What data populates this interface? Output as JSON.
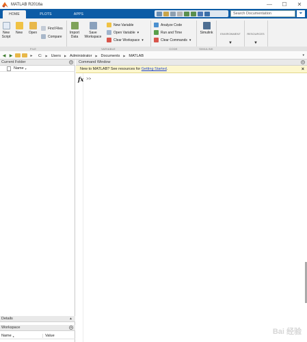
{
  "window": {
    "title": "MATLAB R2016a",
    "controls": [
      "—",
      "☐",
      "✕"
    ]
  },
  "tabs": [
    {
      "label": "HOME",
      "active": true
    },
    {
      "label": "PLOTS",
      "active": false
    },
    {
      "label": "APPS",
      "active": false
    }
  ],
  "search": {
    "placeholder": "Search Documentation"
  },
  "ribbon": {
    "file": {
      "label": "FILE",
      "new_script": "New Script",
      "new": "New",
      "open": "Open",
      "find_files": "Find Files",
      "compare": "Compare"
    },
    "variable": {
      "label": "VARIABLE",
      "import_data": "Import Data",
      "save_workspace": "Save Workspace",
      "new_variable": "New Variable",
      "open_variable": "Open Variable",
      "clear_workspace": "Clear Workspace"
    },
    "code": {
      "label": "CODE",
      "analyze_code": "Analyze Code",
      "run_and_time": "Run and Time",
      "clear_commands": "Clear Commands"
    },
    "simulink": {
      "label": "SIMULINK",
      "simulink": "Simulink"
    },
    "environment": "ENVIRONMENT",
    "resources": "RESOURCES"
  },
  "address": {
    "path": [
      "C:",
      "Users",
      "Administrator",
      "Documents",
      "MATLAB"
    ]
  },
  "panels": {
    "current_folder": {
      "title": "Current Folder",
      "name_col": "Name"
    },
    "details": {
      "title": "Details"
    },
    "workspace": {
      "title": "Workspace",
      "name_col": "Name",
      "value_col": "Value"
    }
  },
  "command_window": {
    "title": "Command Window",
    "banner_text": "New to MATLAB? See resources for ",
    "banner_link": "Getting Started",
    "banner_end": ".",
    "prompt": ">>"
  },
  "watermark": "Bai 经验",
  "colors": {
    "accent": "#0d5ca6",
    "banner": "#fdf7cf",
    "link": "#1a3fcc"
  }
}
